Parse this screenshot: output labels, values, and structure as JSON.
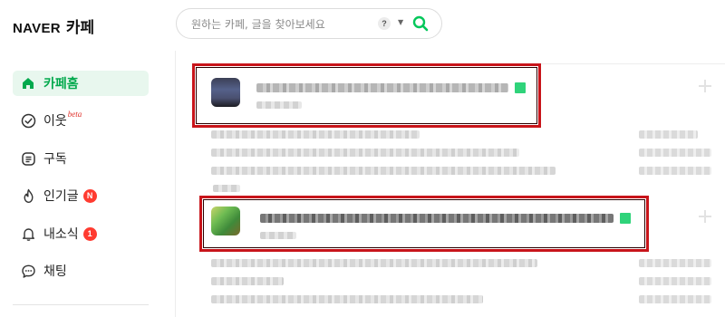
{
  "brand": {
    "naver": "NAVER",
    "cafe": "카페"
  },
  "search": {
    "placeholder": "원하는 카페, 글을 찾아보세요",
    "help": "?",
    "icon": "search-icon"
  },
  "sidebar": {
    "items": [
      {
        "label": "카페홈",
        "icon": "home-icon",
        "active": true
      },
      {
        "label": "이웃",
        "icon": "check-circle-icon",
        "superscript": "beta"
      },
      {
        "label": "구독",
        "icon": "document-icon"
      },
      {
        "label": "인기글",
        "icon": "fire-icon",
        "badge": "N"
      },
      {
        "label": "내소식",
        "icon": "bell-icon",
        "badge": "1"
      },
      {
        "label": "채팅",
        "icon": "chat-bubble-icon"
      }
    ]
  },
  "colors": {
    "accent": "#03a94d",
    "badge": "#ff3b30",
    "highlight": "#c8141a"
  }
}
